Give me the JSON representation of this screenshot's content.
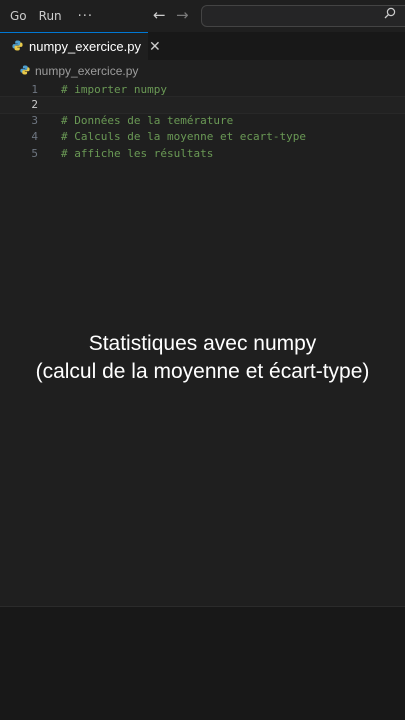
{
  "menu": {
    "items": [
      "Go",
      "Run"
    ],
    "more": "···"
  },
  "nav": {
    "back": "←",
    "forward": "→"
  },
  "tab": {
    "label": "numpy_exercice.py",
    "close": "✕"
  },
  "breadcrumb": {
    "file": "numpy_exercice.py"
  },
  "editor": {
    "lines": [
      {
        "number": "1",
        "text": "# importer numpy"
      },
      {
        "number": "2",
        "text": ""
      },
      {
        "number": "3",
        "text": "# Données de la temérature"
      },
      {
        "number": "4",
        "text": "# Calculs de la moyenne et ecart-type"
      },
      {
        "number": "5",
        "text": "# affiche les résultats"
      }
    ],
    "active_line": "2"
  },
  "overlay": {
    "line1": "Statistiques avec numpy",
    "line2": "(calcul de la moyenne et écart-type)"
  },
  "colors": {
    "comment": "#6a9955",
    "python_icon": "#4f9fcf",
    "tab_accent": "#0078d4"
  },
  "icons": {
    "python": "python-file-icon",
    "search": "search-icon",
    "close": "close-icon"
  }
}
